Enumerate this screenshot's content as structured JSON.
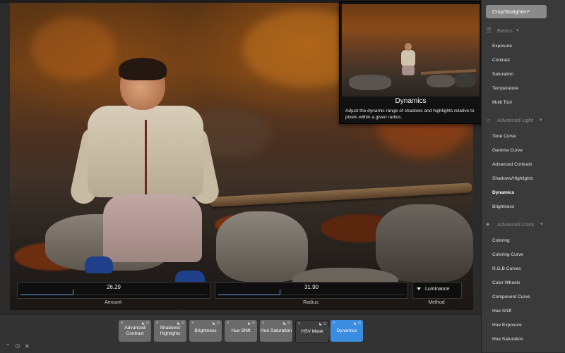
{
  "sliders": [
    {
      "label": "Amount",
      "value": "26.29",
      "fraction": 0.28
    },
    {
      "label": "Radius",
      "value": "31.90",
      "fraction": 0.33
    }
  ],
  "method": {
    "label": "Method",
    "value": "Luminance"
  },
  "tooltip": {
    "title": "Dynamics",
    "description": "Adjust the dynamic range of shadows and highlights relative to pixels within a given radius."
  },
  "panel": {
    "crop_button": "Crop/Straighten*",
    "sections": [
      {
        "title": "Basics",
        "icon": "sliders-icon",
        "items": [
          "Exposure",
          "Contrast",
          "Saturation",
          "Temperature",
          "Multi Tool"
        ]
      },
      {
        "title": "Advanced Light",
        "icon": "sun-icon",
        "items": [
          "Tone Curve",
          "Gamma Curve",
          "Advanced Contrast",
          "Shadows/Highlights",
          "Dynamics",
          "Brightness"
        ]
      },
      {
        "title": "Advanced Color",
        "icon": "droplet-icon",
        "items": [
          "Coloring",
          "Coloring Curve",
          "R,G,B Curves",
          "Color Wheels",
          "Component Curve",
          "Hue Shift",
          "Hue Exposure",
          "Hue Saturation"
        ]
      }
    ],
    "active_item": "Dynamics"
  },
  "tools": [
    {
      "label": "Advanced Contrast"
    },
    {
      "label": "Shadows/ Highlights"
    },
    {
      "label": "Brightness"
    },
    {
      "label": "Hue Shift"
    },
    {
      "label": "Hue Saturation"
    },
    {
      "label": "HSV Mask"
    },
    {
      "label": "Dynamics"
    }
  ],
  "active_tool": "Dynamics",
  "corner_icons": [
    "chevron-up-icon",
    "power-icon",
    "close-icon"
  ],
  "colors": {
    "accent": "#3a8de0",
    "panel_bg": "#3a3a3a",
    "tool_bg": "#6b6b6b"
  }
}
